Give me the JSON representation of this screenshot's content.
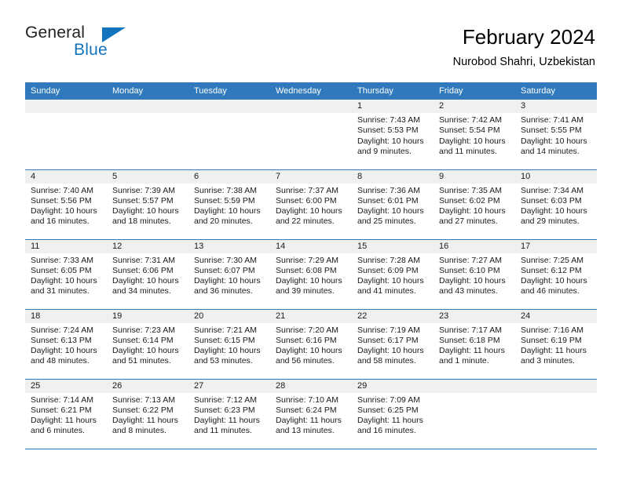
{
  "brand": {
    "name_part1": "General",
    "name_part2": "Blue",
    "triangle_icon": "triangle-icon",
    "accent_color": "#1274bc"
  },
  "header": {
    "title": "February 2024",
    "subtitle": "Nurobod Shahri, Uzbekistan"
  },
  "calendar": {
    "header_bg": "#3079bd",
    "daynum_bg": "#f0f0f0",
    "weekdays": [
      "Sunday",
      "Monday",
      "Tuesday",
      "Wednesday",
      "Thursday",
      "Friday",
      "Saturday"
    ],
    "weeks": [
      [
        {
          "day": "",
          "empty": true
        },
        {
          "day": "",
          "empty": true
        },
        {
          "day": "",
          "empty": true
        },
        {
          "day": "",
          "empty": true
        },
        {
          "day": "1",
          "sunrise": "Sunrise: 7:43 AM",
          "sunset": "Sunset: 5:53 PM",
          "daylight": "Daylight: 10 hours and 9 minutes."
        },
        {
          "day": "2",
          "sunrise": "Sunrise: 7:42 AM",
          "sunset": "Sunset: 5:54 PM",
          "daylight": "Daylight: 10 hours and 11 minutes."
        },
        {
          "day": "3",
          "sunrise": "Sunrise: 7:41 AM",
          "sunset": "Sunset: 5:55 PM",
          "daylight": "Daylight: 10 hours and 14 minutes."
        }
      ],
      [
        {
          "day": "4",
          "sunrise": "Sunrise: 7:40 AM",
          "sunset": "Sunset: 5:56 PM",
          "daylight": "Daylight: 10 hours and 16 minutes."
        },
        {
          "day": "5",
          "sunrise": "Sunrise: 7:39 AM",
          "sunset": "Sunset: 5:57 PM",
          "daylight": "Daylight: 10 hours and 18 minutes."
        },
        {
          "day": "6",
          "sunrise": "Sunrise: 7:38 AM",
          "sunset": "Sunset: 5:59 PM",
          "daylight": "Daylight: 10 hours and 20 minutes."
        },
        {
          "day": "7",
          "sunrise": "Sunrise: 7:37 AM",
          "sunset": "Sunset: 6:00 PM",
          "daylight": "Daylight: 10 hours and 22 minutes."
        },
        {
          "day": "8",
          "sunrise": "Sunrise: 7:36 AM",
          "sunset": "Sunset: 6:01 PM",
          "daylight": "Daylight: 10 hours and 25 minutes."
        },
        {
          "day": "9",
          "sunrise": "Sunrise: 7:35 AM",
          "sunset": "Sunset: 6:02 PM",
          "daylight": "Daylight: 10 hours and 27 minutes."
        },
        {
          "day": "10",
          "sunrise": "Sunrise: 7:34 AM",
          "sunset": "Sunset: 6:03 PM",
          "daylight": "Daylight: 10 hours and 29 minutes."
        }
      ],
      [
        {
          "day": "11",
          "sunrise": "Sunrise: 7:33 AM",
          "sunset": "Sunset: 6:05 PM",
          "daylight": "Daylight: 10 hours and 31 minutes."
        },
        {
          "day": "12",
          "sunrise": "Sunrise: 7:31 AM",
          "sunset": "Sunset: 6:06 PM",
          "daylight": "Daylight: 10 hours and 34 minutes."
        },
        {
          "day": "13",
          "sunrise": "Sunrise: 7:30 AM",
          "sunset": "Sunset: 6:07 PM",
          "daylight": "Daylight: 10 hours and 36 minutes."
        },
        {
          "day": "14",
          "sunrise": "Sunrise: 7:29 AM",
          "sunset": "Sunset: 6:08 PM",
          "daylight": "Daylight: 10 hours and 39 minutes."
        },
        {
          "day": "15",
          "sunrise": "Sunrise: 7:28 AM",
          "sunset": "Sunset: 6:09 PM",
          "daylight": "Daylight: 10 hours and 41 minutes."
        },
        {
          "day": "16",
          "sunrise": "Sunrise: 7:27 AM",
          "sunset": "Sunset: 6:10 PM",
          "daylight": "Daylight: 10 hours and 43 minutes."
        },
        {
          "day": "17",
          "sunrise": "Sunrise: 7:25 AM",
          "sunset": "Sunset: 6:12 PM",
          "daylight": "Daylight: 10 hours and 46 minutes."
        }
      ],
      [
        {
          "day": "18",
          "sunrise": "Sunrise: 7:24 AM",
          "sunset": "Sunset: 6:13 PM",
          "daylight": "Daylight: 10 hours and 48 minutes."
        },
        {
          "day": "19",
          "sunrise": "Sunrise: 7:23 AM",
          "sunset": "Sunset: 6:14 PM",
          "daylight": "Daylight: 10 hours and 51 minutes."
        },
        {
          "day": "20",
          "sunrise": "Sunrise: 7:21 AM",
          "sunset": "Sunset: 6:15 PM",
          "daylight": "Daylight: 10 hours and 53 minutes."
        },
        {
          "day": "21",
          "sunrise": "Sunrise: 7:20 AM",
          "sunset": "Sunset: 6:16 PM",
          "daylight": "Daylight: 10 hours and 56 minutes."
        },
        {
          "day": "22",
          "sunrise": "Sunrise: 7:19 AM",
          "sunset": "Sunset: 6:17 PM",
          "daylight": "Daylight: 10 hours and 58 minutes."
        },
        {
          "day": "23",
          "sunrise": "Sunrise: 7:17 AM",
          "sunset": "Sunset: 6:18 PM",
          "daylight": "Daylight: 11 hours and 1 minute."
        },
        {
          "day": "24",
          "sunrise": "Sunrise: 7:16 AM",
          "sunset": "Sunset: 6:19 PM",
          "daylight": "Daylight: 11 hours and 3 minutes."
        }
      ],
      [
        {
          "day": "25",
          "sunrise": "Sunrise: 7:14 AM",
          "sunset": "Sunset: 6:21 PM",
          "daylight": "Daylight: 11 hours and 6 minutes."
        },
        {
          "day": "26",
          "sunrise": "Sunrise: 7:13 AM",
          "sunset": "Sunset: 6:22 PM",
          "daylight": "Daylight: 11 hours and 8 minutes."
        },
        {
          "day": "27",
          "sunrise": "Sunrise: 7:12 AM",
          "sunset": "Sunset: 6:23 PM",
          "daylight": "Daylight: 11 hours and 11 minutes."
        },
        {
          "day": "28",
          "sunrise": "Sunrise: 7:10 AM",
          "sunset": "Sunset: 6:24 PM",
          "daylight": "Daylight: 11 hours and 13 minutes."
        },
        {
          "day": "29",
          "sunrise": "Sunrise: 7:09 AM",
          "sunset": "Sunset: 6:25 PM",
          "daylight": "Daylight: 11 hours and 16 minutes."
        },
        {
          "day": "",
          "empty": true
        },
        {
          "day": "",
          "empty": true
        }
      ]
    ]
  }
}
